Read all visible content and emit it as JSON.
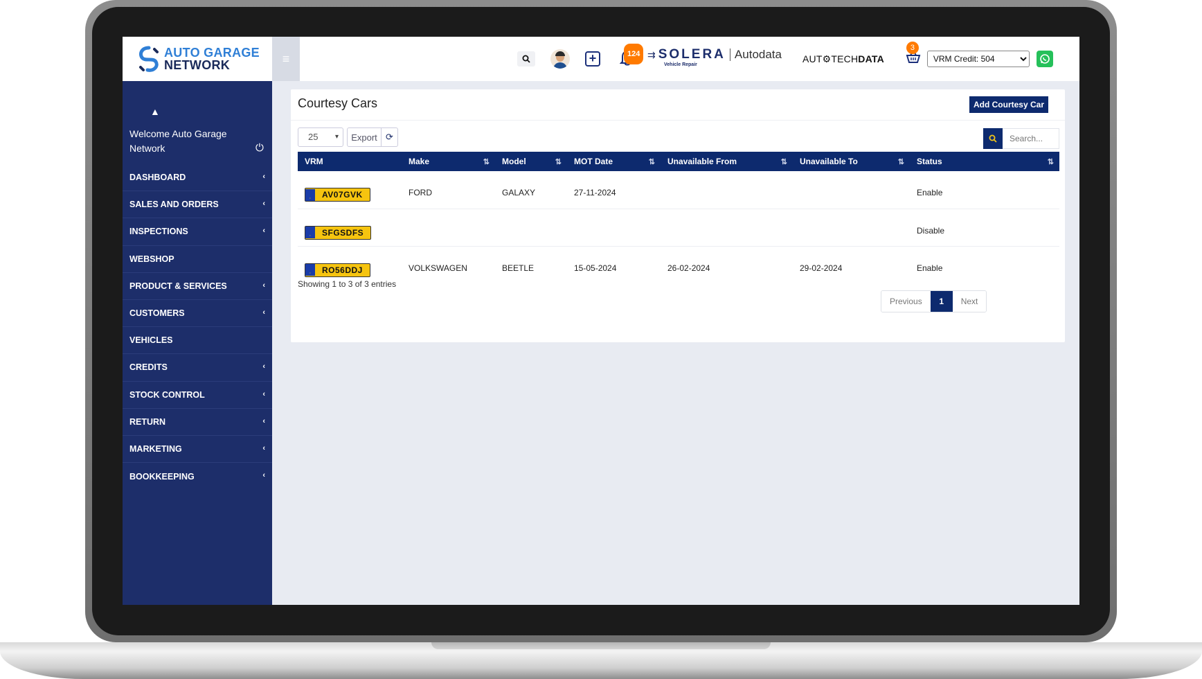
{
  "brand": {
    "line1": "AUTO GARAGE",
    "line2": "NETWORK"
  },
  "header": {
    "notifications_count": "124",
    "solera_word": "SOLERA",
    "solera_sub": "Vehicle Repair",
    "autodata": "Autodata",
    "autotech_a": "AUT",
    "autotech_b": "TECH",
    "autotech_c": "DATA",
    "cart_count": "3",
    "vrm_credit": "VRM Credit: 504"
  },
  "sidebar": {
    "welcome": "Welcome Auto Garage Network",
    "items": [
      {
        "label": "DASHBOARD",
        "has_submenu": true
      },
      {
        "label": "SALES AND ORDERS",
        "has_submenu": true
      },
      {
        "label": "INSPECTIONS",
        "has_submenu": true
      },
      {
        "label": "WEBSHOP",
        "has_submenu": false
      },
      {
        "label": "PRODUCT & SERVICES",
        "has_submenu": true
      },
      {
        "label": "CUSTOMERS",
        "has_submenu": true
      },
      {
        "label": "VEHICLES",
        "has_submenu": false
      },
      {
        "label": "CREDITS",
        "has_submenu": true
      },
      {
        "label": "STOCK CONTROL",
        "has_submenu": true
      },
      {
        "label": "RETURN",
        "has_submenu": true
      },
      {
        "label": "MARKETING",
        "has_submenu": true
      },
      {
        "label": "BOOKKEEPING",
        "has_submenu": true
      }
    ]
  },
  "main": {
    "title": "Courtesy Cars",
    "add_button": "Add Courtesy Car",
    "page_length": "25",
    "export_label": "Export",
    "search_placeholder": "Search...",
    "columns": [
      "VRM",
      "Make",
      "Model",
      "MOT Date",
      "Unavailable From",
      "Unavailable To",
      "Status"
    ],
    "rows": [
      {
        "vrm": "AV07GVK",
        "make": "FORD",
        "model": "GALAXY",
        "mot": "27-11-2024",
        "from": "",
        "to": "",
        "status": "Enable"
      },
      {
        "vrm": "SFGSDFS",
        "make": "",
        "model": "",
        "mot": "",
        "from": "",
        "to": "",
        "status": "Disable"
      },
      {
        "vrm": "RO56DDJ",
        "make": "VOLKSWAGEN",
        "model": "BEETLE",
        "mot": "15-05-2024",
        "from": "26-02-2024",
        "to": "29-02-2024",
        "status": "Enable"
      }
    ],
    "showing": "Showing 1 to 3 of 3 entries",
    "pagination": {
      "previous": "Previous",
      "current": "1",
      "next": "Next"
    }
  },
  "colors": {
    "sidebar_bg": "#1d2e6a",
    "primary": "#0d2a6e",
    "badge": "#ff7a00",
    "plate": "#f6c40f",
    "enable": "#1a8a2a",
    "disable": "#e33333",
    "whatsapp": "#25c05a"
  }
}
